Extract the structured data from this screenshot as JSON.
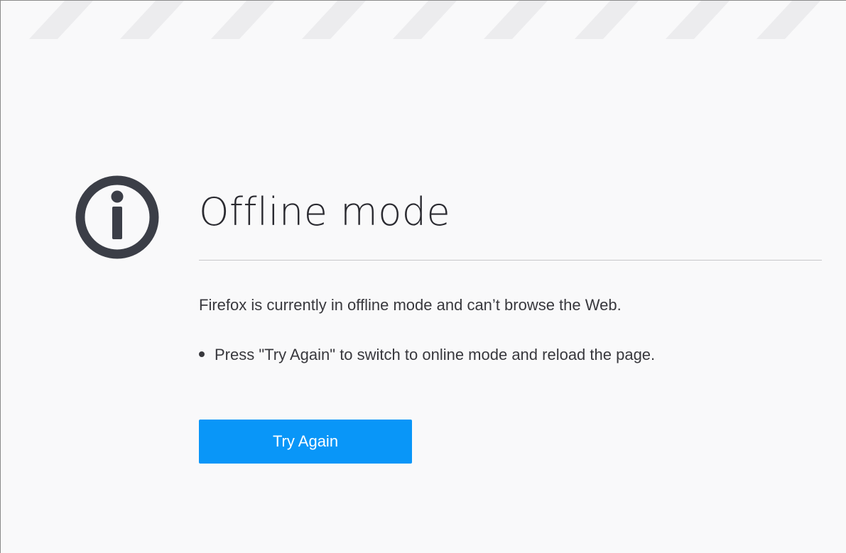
{
  "page": {
    "title": "Offline mode",
    "description": "Firefox is currently in offline mode and can’t browse the Web.",
    "bullets": [
      "Press \"Try Again\" to switch to online mode and reload the page."
    ],
    "try_again_label": "Try Again"
  },
  "icons": {
    "main": "info-icon"
  },
  "colors": {
    "background": "#f9f9fa",
    "stripe": "#ececee",
    "icon": "#3b3e47",
    "text": "#38383d",
    "title": "#2b2b31",
    "divider": "#c7c7c9",
    "button": "#0996f8",
    "button_text": "#ffffff"
  }
}
